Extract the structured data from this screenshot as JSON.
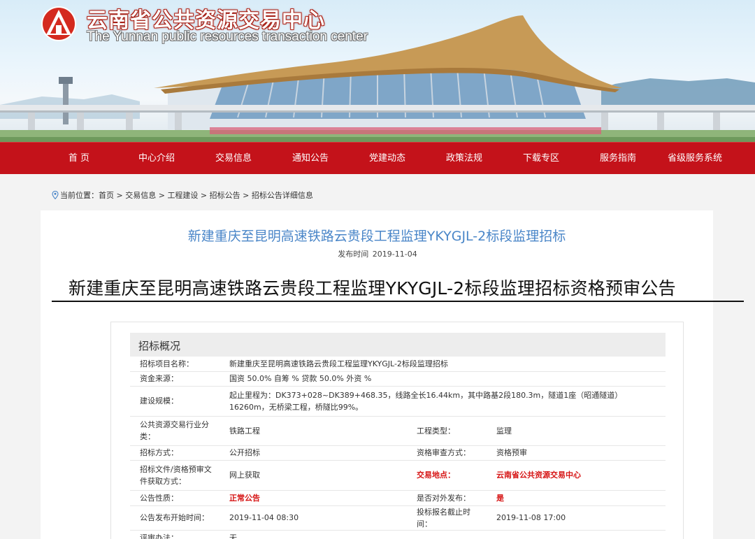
{
  "header": {
    "title": "云南省公共资源交易中心",
    "subtitle": "The Yunnan public resources transaction center"
  },
  "nav": [
    "首 页",
    "中心介绍",
    "交易信息",
    "通知公告",
    "党建动态",
    "政策法规",
    "下载专区",
    "服务指南",
    "省级服务系统"
  ],
  "breadcrumb": {
    "label": "当前位置：",
    "items": [
      "首页",
      "交易信息",
      "工程建设",
      "招标公告",
      "招标公告详细信息"
    ],
    "separator": " > "
  },
  "document": {
    "title": "新建重庆至昆明高速铁路云贵段工程监理YKYGJL-2标段监理招标",
    "publish_label": "发布时间",
    "publish_date": "2019-11-04",
    "notice_heading": "新建重庆至昆明高速铁路云贵段工程监理YKYGJL-2标段监理招标资格预审公告"
  },
  "overview": {
    "heading": "招标概况",
    "rows": {
      "project_name": {
        "label": "招标项目名称：",
        "value": "新建重庆至昆明高速铁路云贵段工程监理YKYGJL-2标段监理招标"
      },
      "fund_source": {
        "label": "资金来源：",
        "value": "国资 50.0% 自筹 % 贷款 50.0% 外资 %"
      },
      "scale": {
        "label": "建设规模：",
        "value": "起止里程为：DK373+028~DK389+468.35，线路全长16.44km，其中路基2段180.3m，隧道1座（昭通隧道）16260m，无桥梁工程，桥隧比99%。"
      },
      "industry": {
        "label": "公共资源交易行业分类：",
        "value": "铁路工程",
        "label2": "工程类型：",
        "value2": "监理"
      },
      "method": {
        "label": "招标方式：",
        "value": "公开招标",
        "label2": "资格审查方式：",
        "value2": "资格预审"
      },
      "doc_access": {
        "label": "招标文件/资格预审文件获取方式：",
        "value": "网上获取",
        "label2": "交易地点：",
        "value2": "云南省公共资源交易中心"
      },
      "nature": {
        "label": "公告性质：",
        "value": "正常公告",
        "label2": "是否对外发布：",
        "value2": "是"
      },
      "start_time": {
        "label": "公告发布开始时间：",
        "value": "2019-11-04 08:30",
        "label2": "投标报名截止时间：",
        "value2": "2019-11-08 17:00"
      },
      "evaluation": {
        "label": "评审办法：",
        "value": "无"
      }
    }
  },
  "colors": {
    "nav_red": "#c4121a",
    "title_blue": "#4a86c8",
    "highlight_red": "#d61414"
  }
}
